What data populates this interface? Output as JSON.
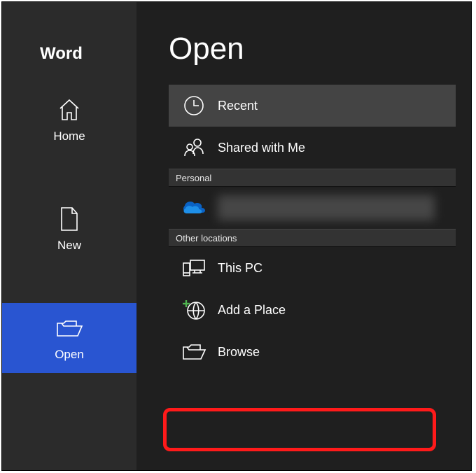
{
  "sidebar": {
    "title": "Word",
    "items": [
      {
        "label": "Home",
        "icon": "home-icon",
        "selected": false
      },
      {
        "label": "New",
        "icon": "new-document-icon",
        "selected": false
      },
      {
        "label": "Open",
        "icon": "open-folder-icon",
        "selected": true
      }
    ]
  },
  "main": {
    "title": "Open",
    "sections": {
      "top": [
        {
          "label": "Recent",
          "icon": "clock-icon",
          "selected": true
        },
        {
          "label": "Shared with Me",
          "icon": "people-icon",
          "selected": false
        }
      ],
      "personal_header": "Personal",
      "personal_account": {
        "icon": "onedrive-icon",
        "redacted": true
      },
      "other_header": "Other locations",
      "other": [
        {
          "label": "This PC",
          "icon": "this-pc-icon"
        },
        {
          "label": "Add a Place",
          "icon": "add-place-icon"
        },
        {
          "label": "Browse",
          "icon": "browse-folder-icon"
        }
      ]
    }
  },
  "annotation": {
    "highlight_target": "browse-location"
  }
}
